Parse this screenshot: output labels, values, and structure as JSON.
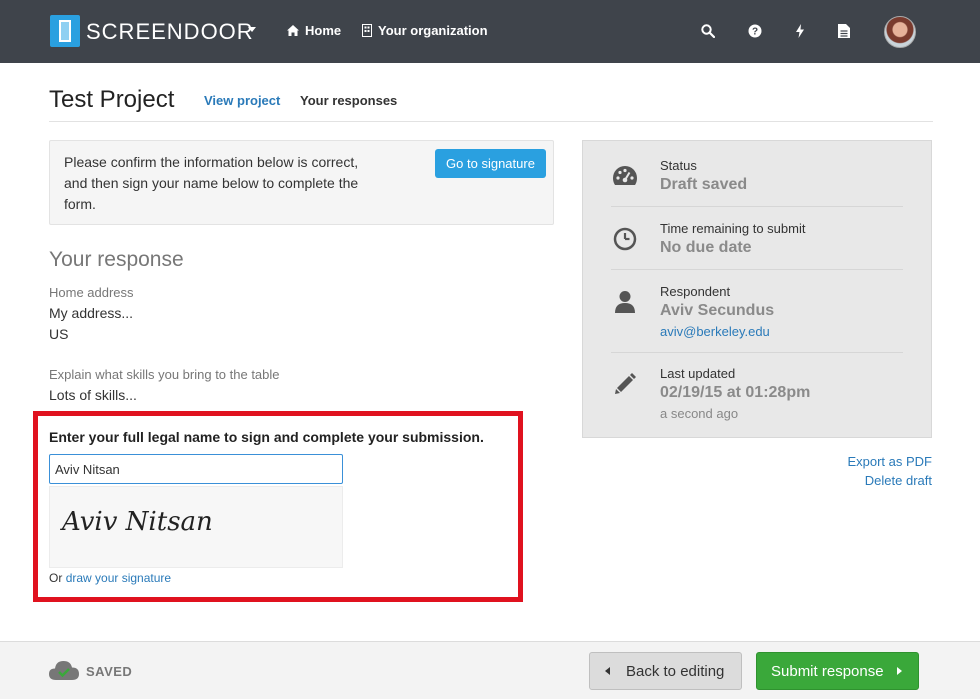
{
  "app": {
    "brand": "SCREENDOOR",
    "nav": {
      "home": "Home",
      "organization": "Your organization"
    },
    "toolbar_icons": [
      "search-icon",
      "help-icon",
      "bolt-icon",
      "document-icon"
    ]
  },
  "header": {
    "title": "Test Project",
    "tabs": {
      "view_project": "View project",
      "your_responses": "Your responses"
    }
  },
  "notice": {
    "text": "Please confirm the information below is correct, and then sign your name below to complete the form.",
    "button": "Go to signature"
  },
  "response": {
    "heading": "Your response",
    "fields": [
      {
        "label": "Home address",
        "lines": [
          "My address...",
          "US"
        ]
      },
      {
        "label": "Explain what skills you bring to the table",
        "lines": [
          "Lots of skills..."
        ]
      }
    ]
  },
  "signature": {
    "instruction": "Enter your full legal name to sign and complete your submission.",
    "name_value": "Aviv Nitsan",
    "preview": "Aviv Nitsan",
    "alt_prefix": "Or",
    "alt_link": "draw your signature"
  },
  "status_panel": {
    "status": {
      "label": "Status",
      "value": "Draft saved"
    },
    "time": {
      "label": "Time remaining to submit",
      "value": "No due date"
    },
    "respondent": {
      "label": "Respondent",
      "value": "Aviv Secundus",
      "email": "aviv@berkeley.edu"
    },
    "updated": {
      "label": "Last updated",
      "value": "02/19/15 at 01:28pm",
      "relative": "a second ago"
    }
  },
  "side_links": {
    "export": "Export as PDF",
    "delete": "Delete draft"
  },
  "footer": {
    "saved": "SAVED",
    "back": "Back to editing",
    "submit": "Submit response"
  },
  "colors": {
    "topbar": "#3f444b",
    "accent_blue": "#2aa0e0",
    "link": "#2a7ab9",
    "highlight": "#e0121f",
    "submit_green": "#3aa83a"
  }
}
